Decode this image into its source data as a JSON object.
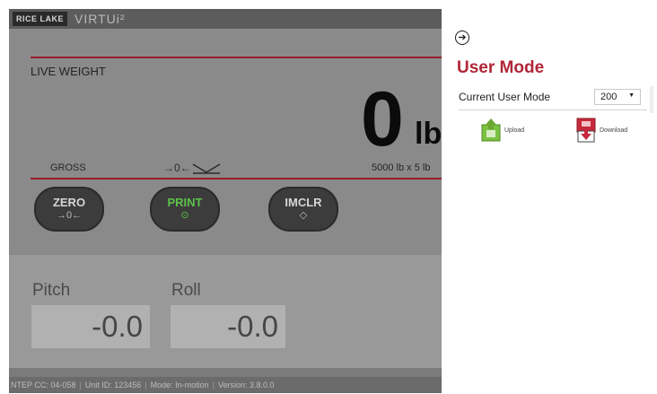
{
  "header": {
    "logo_text": "RICE LAKE",
    "brand_text": "VIRTUi²"
  },
  "weight": {
    "live_label": "LIVE WEIGHT",
    "value": "0",
    "unit": "lb",
    "mode_label": "GROSS",
    "center_of_zero_symbol": "→0←",
    "capacity": "5000 lb x 5 lb"
  },
  "buttons": {
    "zero": {
      "label": "ZERO",
      "symbol": "→0←"
    },
    "print": {
      "label": "PRINT",
      "symbol": "⊙"
    },
    "imclr": {
      "label": "IMCLR",
      "symbol": "◇"
    }
  },
  "tilt": {
    "pitch_label": "Pitch",
    "pitch_value": "-0.0",
    "roll_label": "Roll",
    "roll_value": "-0.0"
  },
  "footer": {
    "ntep": "NTEP CC: 04-058",
    "unit_id": "Unit ID: 123456",
    "mode": "Mode: In-motion",
    "version": "Version: 3.8.0.0"
  },
  "side_panel": {
    "title": "User Mode",
    "current_mode_label": "Current User Mode",
    "current_mode_value": "200",
    "upload_label": "Upload",
    "download_label": "Download"
  },
  "colors": {
    "accent_red": "#b02638",
    "redline": "#9a1e2a",
    "print_green": "#5ec24a",
    "upload_green": "#7cc242",
    "download_red": "#c8283c"
  },
  "icons": {
    "collapse": "arrow-right-circle-icon",
    "upload": "upload-icon",
    "download": "download-icon",
    "motion": "motion-envelope-icon"
  }
}
